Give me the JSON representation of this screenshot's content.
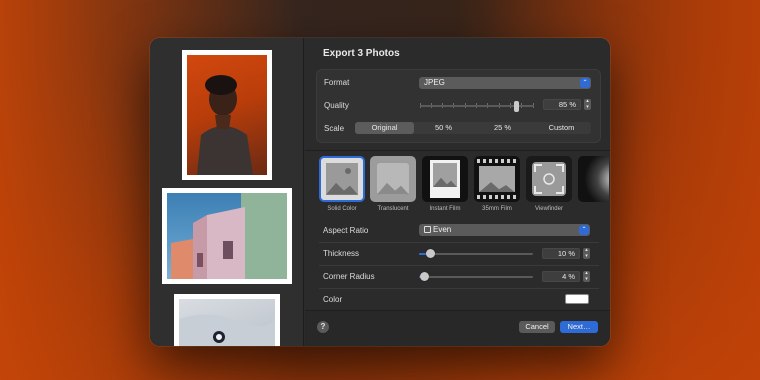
{
  "dialog": {
    "title": "Export 3 Photos"
  },
  "format": {
    "label": "Format",
    "value": "JPEG"
  },
  "quality": {
    "label": "Quality",
    "value": "85 %",
    "level_percent": 85
  },
  "scale": {
    "label": "Scale",
    "options": [
      "Original",
      "50 %",
      "25 %",
      "Custom"
    ],
    "selected": "Original"
  },
  "border_styles": [
    {
      "label": "Solid Color",
      "selected": true
    },
    {
      "label": "Translucent",
      "selected": false
    },
    {
      "label": "Instant Film",
      "selected": false
    },
    {
      "label": "35mm Film",
      "selected": false
    },
    {
      "label": "Viewfinder",
      "selected": false
    }
  ],
  "aspect_ratio": {
    "label": "Aspect Ratio",
    "value": "Even",
    "value_icon": "square-icon"
  },
  "thickness": {
    "label": "Thickness",
    "value": "10 %",
    "level_percent": 10
  },
  "corner_radius": {
    "label": "Corner Radius",
    "value": "4 %",
    "level_percent": 4
  },
  "color": {
    "label": "Color",
    "value_hex": "#ffffff"
  },
  "footer": {
    "help_label": "?",
    "cancel_label": "Cancel",
    "next_label": "Next…"
  },
  "colors": {
    "accent": "#2f6bd6",
    "window_bg": "#2b2b2b",
    "desktop_orange": "#c84606"
  }
}
